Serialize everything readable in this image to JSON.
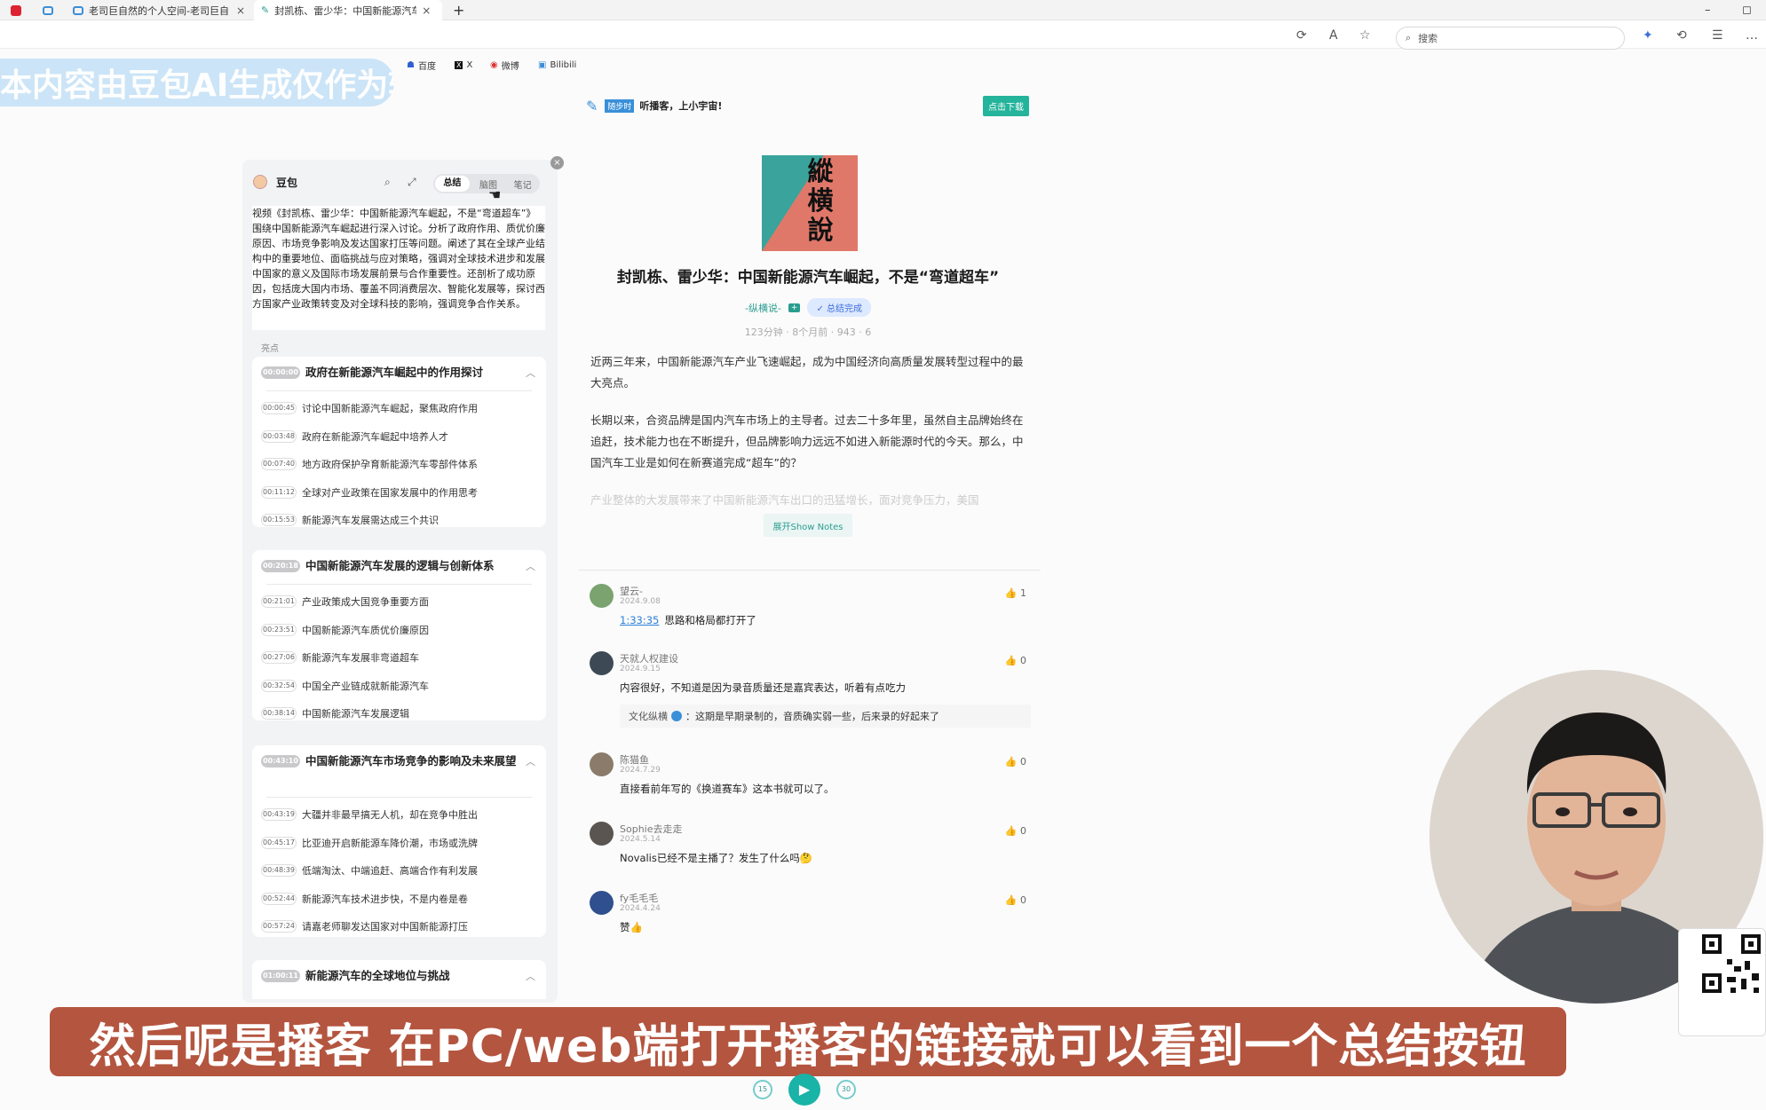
{
  "browser": {
    "tabs": [
      {
        "label": "老司巨自然的个人空间-老司巨自",
        "close": "×"
      },
      {
        "label": "封凯栋、雷少华：中国新能源汽车",
        "close": "×"
      }
    ],
    "new_tab": "+",
    "window_controls": [
      "–",
      "◻"
    ],
    "search_placeholder": "搜索",
    "bookmarks": [
      {
        "label": "百度"
      },
      {
        "label": "X"
      },
      {
        "label": "微博"
      },
      {
        "label": "Bilibili"
      }
    ]
  },
  "watermark": "本内容由豆包AI生成仅作为辅助样例",
  "header": {
    "brand_tag": "随步时",
    "tagline": "听播客，上小宇宙!",
    "download": "点击下载"
  },
  "sidebar": {
    "assistant_name": "豆包",
    "tabs": [
      "总结",
      "脑图",
      "笔记"
    ],
    "active_tab": "总结",
    "close": "×",
    "summary": "视频《封凯栋、雷少华：中国新能源汽车崛起，不是“弯道超车”》围绕中国新能源汽车崛起进行深入讨论。分析了政府作用、质优价廉原因、市场竞争影响及发达国家打压等问题。阐述了其在全球产业结构中的重要地位、面临挑战与应对策略，强调对全球技术进步和发展中国家的意义及国际市场发展前景与合作重要性。还剖析了成功原因，包括庞大国内市场、覆盖不同消费层次、智能化发展等，探讨西方国家产业政策转变及对全球科技的影响，强调竞争合作关系。",
    "highlights_label": "亮点",
    "sections": [
      {
        "time": "00:00:00",
        "title": "政府在新能源汽车崛起中的作用探讨",
        "items": [
          {
            "time": "00:00:45",
            "text": "讨论中国新能源汽车崛起，聚焦政府作用"
          },
          {
            "time": "00:03:48",
            "text": "政府在新能源汽车崛起中培养人才"
          },
          {
            "time": "00:07:40",
            "text": "地方政府保护孕育新能源汽车零部件体系"
          },
          {
            "time": "00:11:12",
            "text": "全球对产业政策在国家发展中的作用思考"
          },
          {
            "time": "00:15:53",
            "text": "新能源汽车发展需达成三个共识"
          }
        ]
      },
      {
        "time": "00:20:18",
        "title": "中国新能源汽车发展的逻辑与创新体系",
        "items": [
          {
            "time": "00:21:01",
            "text": "产业政策成大国竞争重要方面"
          },
          {
            "time": "00:23:51",
            "text": "中国新能源汽车质优价廉原因"
          },
          {
            "time": "00:27:06",
            "text": "新能源汽车发展非弯道超车"
          },
          {
            "time": "00:32:54",
            "text": "中国全产业链成就新能源汽车"
          },
          {
            "time": "00:38:14",
            "text": "中国新能源汽车发展逻辑"
          }
        ]
      },
      {
        "time": "00:43:10",
        "title": "中国新能源汽车市场竞争的影响及未来展望",
        "items": [
          {
            "time": "00:43:19",
            "text": "大疆并非最早搞无人机，却在竞争中胜出"
          },
          {
            "time": "00:45:17",
            "text": "比亚迪开启新能源车降价潮，市场或洗牌"
          },
          {
            "time": "00:48:39",
            "text": "低端淘汰、中端追赶、高端合作有利发展"
          },
          {
            "time": "00:52:44",
            "text": "新能源汽车技术进步快，不是内卷是卷"
          },
          {
            "time": "00:57:24",
            "text": "请嘉老师聊发达国家对中国新能源打压"
          }
        ]
      },
      {
        "time": "01:00:11",
        "title": "新能源汽车的全球地位与挑战",
        "items": []
      }
    ]
  },
  "episode": {
    "cover_text": "縱横說",
    "title": "封凯栋、雷少华：中国新能源汽车崛起，不是“弯道超车”",
    "podcast": "-纵横说-",
    "summary_done": "✓ 总结完成",
    "meta": "123分钟 · 8个月前 · 943 · 6",
    "paragraphs": [
      "近两三年来，中国新能源汽车产业飞速崛起，成为中国经济向高质量发展转型过程中的最大亮点。",
      "长期以来，合资品牌是国内汽车市场上的主导者。过去二十多年里，虽然自主品牌始终在追赶，技术能力也在不断提升，但品牌影响力远远不如进入新能源时代的今天。那么，中国汽车工业是如何在新赛道完成“超车”的？",
      "产业整体的大发展带来了中国新能源汽车出口的迅猛增长，面对竞争压力，美国"
    ],
    "show_notes": "展开Show Notes"
  },
  "comments": [
    {
      "name": "望云-",
      "date": "2024.9.08",
      "text": "思路和格局都打开了",
      "timestamp": "1:33:35",
      "likes": "1",
      "avatar_color": "#7aa36f"
    },
    {
      "name": "天就人权建设",
      "date": "2024.9.15",
      "text": "内容很好，不知道是因为录音质量还是嘉宾表达，听着有点吃力",
      "likes": "0",
      "avatar_color": "#3d4a55",
      "reply": {
        "author": "文化纵横",
        "text": "：这期是早期录制的，音质确实弱一些，后来录的好起来了"
      }
    },
    {
      "name": "陈猫鱼",
      "date": "2024.7.29",
      "text": "直接看前年写的《换道赛车》这本书就可以了。",
      "likes": "0",
      "avatar_color": "#8a7b6a"
    },
    {
      "name": "Sophie去走走",
      "date": "2024.5.14",
      "text": "Novalis已经不是主播了？发生了什么吗🤔",
      "likes": "0",
      "avatar_color": "#5a5550"
    },
    {
      "name": "fy毛毛毛",
      "date": "2024.4.24",
      "text": "赞👍",
      "likes": "0",
      "avatar_color": "#2f4f8f"
    }
  ],
  "player": {
    "back": "15",
    "forward": "30"
  },
  "caption": "然后呢是播客 在PC/web端打开播客的链接就可以看到一个总结按钮"
}
